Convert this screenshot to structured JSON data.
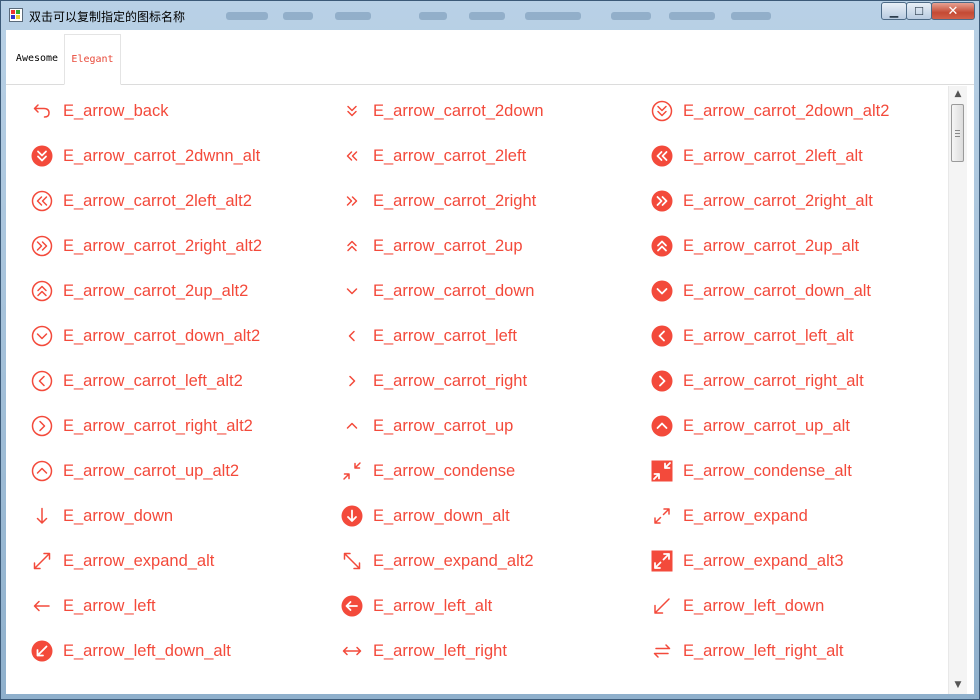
{
  "window": {
    "title": "双击可以复制指定的图标名称",
    "controls": {
      "minimize": "▁",
      "maximize": "☐",
      "close": "✕"
    }
  },
  "tabs": [
    {
      "label": "Awesome",
      "selected": false
    },
    {
      "label": "Elegant",
      "selected": true
    }
  ],
  "colors": {
    "accent": "#f34a3b",
    "selected_tab": "#e84a3a"
  },
  "icons": [
    {
      "label": "E_arrow_back",
      "icon": "arrow-back-icon"
    },
    {
      "label": "E_arrow_carrot_2down",
      "icon": "carrot-2down-icon"
    },
    {
      "label": "E_arrow_carrot_2down_alt2",
      "icon": "carrot-2down-alt2-icon"
    },
    {
      "label": "E_arrow_carrot_2dwnn_alt",
      "icon": "carrot-2down-alt-icon"
    },
    {
      "label": "E_arrow_carrot_2left",
      "icon": "carrot-2left-icon"
    },
    {
      "label": "E_arrow_carrot_2left_alt",
      "icon": "carrot-2left-alt-icon"
    },
    {
      "label": "E_arrow_carrot_2left_alt2",
      "icon": "carrot-2left-alt2-icon"
    },
    {
      "label": "E_arrow_carrot_2right",
      "icon": "carrot-2right-icon"
    },
    {
      "label": "E_arrow_carrot_2right_alt",
      "icon": "carrot-2right-alt-icon"
    },
    {
      "label": "E_arrow_carrot_2right_alt2",
      "icon": "carrot-2right-alt2-icon"
    },
    {
      "label": "E_arrow_carrot_2up",
      "icon": "carrot-2up-icon"
    },
    {
      "label": "E_arrow_carrot_2up_alt",
      "icon": "carrot-2up-alt-icon"
    },
    {
      "label": "E_arrow_carrot_2up_alt2",
      "icon": "carrot-2up-alt2-icon"
    },
    {
      "label": "E_arrow_carrot_down",
      "icon": "carrot-down-icon"
    },
    {
      "label": "E_arrow_carrot_down_alt",
      "icon": "carrot-down-alt-icon"
    },
    {
      "label": "E_arrow_carrot_down_alt2",
      "icon": "carrot-down-alt2-icon"
    },
    {
      "label": "E_arrow_carrot_left",
      "icon": "carrot-left-icon"
    },
    {
      "label": "E_arrow_carrot_left_alt",
      "icon": "carrot-left-alt-icon"
    },
    {
      "label": "E_arrow_carrot_left_alt2",
      "icon": "carrot-left-alt2-icon"
    },
    {
      "label": "E_arrow_carrot_right",
      "icon": "carrot-right-icon"
    },
    {
      "label": "E_arrow_carrot_right_alt",
      "icon": "carrot-right-alt-icon"
    },
    {
      "label": "E_arrow_carrot_right_alt2",
      "icon": "carrot-right-alt2-icon"
    },
    {
      "label": "E_arrow_carrot_up",
      "icon": "carrot-up-icon"
    },
    {
      "label": "E_arrow_carrot_up_alt",
      "icon": "carrot-up-alt-icon"
    },
    {
      "label": "E_arrow_carrot_up_alt2",
      "icon": "carrot-up-alt2-icon"
    },
    {
      "label": "E_arrow_condense",
      "icon": "condense-icon"
    },
    {
      "label": "E_arrow_condense_alt",
      "icon": "condense-alt-icon"
    },
    {
      "label": "E_arrow_down",
      "icon": "arrow-down-icon"
    },
    {
      "label": "E_arrow_down_alt",
      "icon": "arrow-down-alt-icon"
    },
    {
      "label": "E_arrow_expand",
      "icon": "expand-icon"
    },
    {
      "label": "E_arrow_expand_alt",
      "icon": "expand-alt-icon"
    },
    {
      "label": "E_arrow_expand_alt2",
      "icon": "expand-alt2-icon"
    },
    {
      "label": "E_arrow_expand_alt3",
      "icon": "expand-alt3-icon"
    },
    {
      "label": "E_arrow_left",
      "icon": "arrow-left-icon"
    },
    {
      "label": "E_arrow_left_alt",
      "icon": "arrow-left-alt-icon"
    },
    {
      "label": "E_arrow_left_down",
      "icon": "arrow-left-down-icon"
    },
    {
      "label": "E_arrow_left_down_alt",
      "icon": "arrow-left-down-alt-icon"
    },
    {
      "label": "E_arrow_left_right",
      "icon": "arrow-left-right-icon"
    },
    {
      "label": "E_arrow_left_right_alt",
      "icon": "arrow-left-right-alt-icon"
    }
  ],
  "scrollbar": {
    "up": "▲",
    "down": "▼"
  }
}
